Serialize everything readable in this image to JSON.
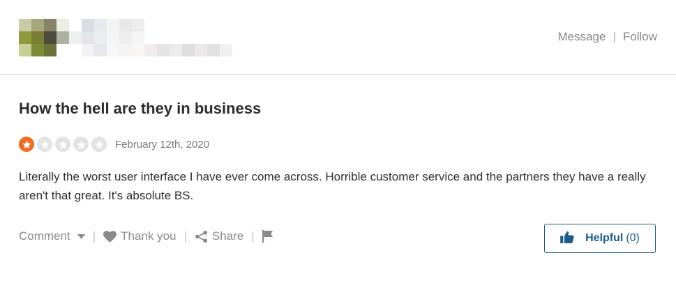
{
  "header": {
    "message_label": "Message",
    "separator": "|",
    "follow_label": "Follow"
  },
  "review": {
    "title": "How the hell are they in business",
    "rating": {
      "value": 1,
      "max": 5
    },
    "date": "February 12th, 2020",
    "body": "Literally the worst user interface I have ever come across. Horrible customer service and the partners they have a really aren't that great. It's absolute BS."
  },
  "actions": {
    "comment_label": "Comment",
    "thank_label": "Thank you",
    "share_label": "Share",
    "separator": "|",
    "helpful_label": "Helpful",
    "helpful_count": "(0)"
  },
  "colors": {
    "accent_orange": "#f26b21",
    "link_blue": "#1c5b8e",
    "muted_gray": "#8a8a8a"
  },
  "icons": {
    "avatar": "pixelated-avatar-redacted",
    "comment_dropdown": "caret-down-icon",
    "thank": "heart-icon",
    "share": "share-icon",
    "report": "flag-icon",
    "helpful": "thumbs-up-icon"
  }
}
